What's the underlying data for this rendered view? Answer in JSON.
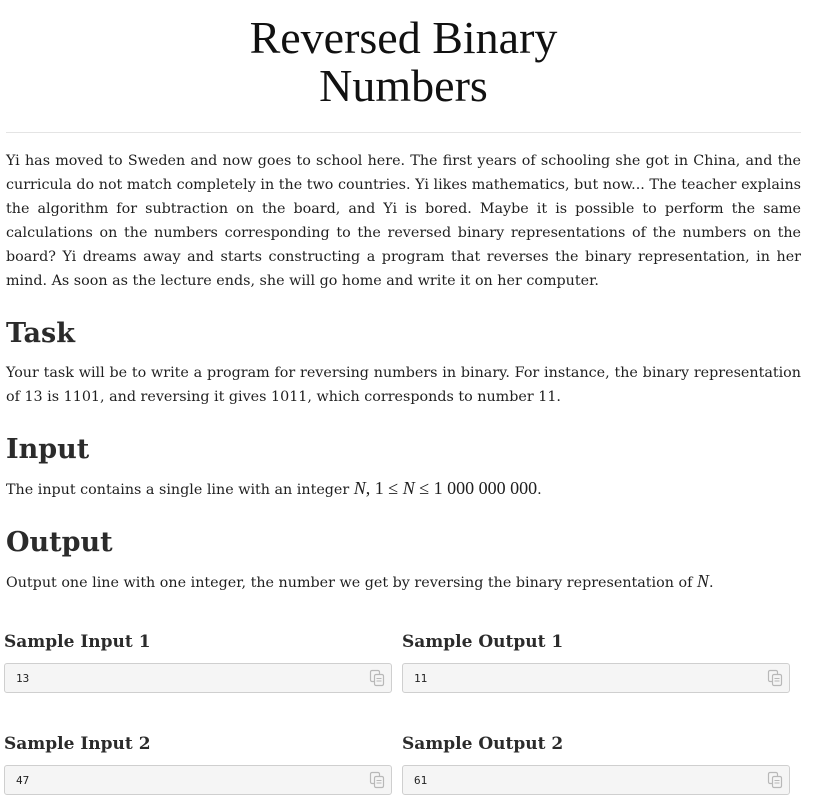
{
  "title": "Reversed Binary Numbers",
  "intro": "Yi has moved to Sweden and now goes to school here. The first years of schooling she got in China, and the curricula do not match completely in the two countries. Yi likes mathematics, but now... The teacher explains the algorithm for subtraction on the board, and Yi is bored. Maybe it is possible to perform the same calculations on the numbers corresponding to the reversed binary representations of the numbers on the board? Yi dreams away and starts constructing a program that reverses the binary representation, in her mind. As soon as the lecture ends, she will go home and write it on her computer.",
  "task": {
    "heading": "Task",
    "text": "Your task will be to write a program for reversing numbers in binary. For instance, the binary representation of 13 is 1101, and reversing it gives 1011, which corresponds to number 11."
  },
  "input": {
    "heading": "Input",
    "text_before": "The input contains a single line with an integer ",
    "var": "N",
    "math_mid": ", 1 ≤ ",
    "var2": "N",
    "math_end": " ≤ 1 000 000 000",
    "text_after": "."
  },
  "output": {
    "heading": "Output",
    "text_before": "Output one line with one integer, the number we get by reversing the binary representation of ",
    "var": "N",
    "text_after": "."
  },
  "samples": [
    {
      "input_label": "Sample Input 1",
      "input_value": "13",
      "output_label": "Sample Output 1",
      "output_value": "11"
    },
    {
      "input_label": "Sample Input 2",
      "input_value": "47",
      "output_label": "Sample Output 2",
      "output_value": "61"
    }
  ],
  "icons": {
    "copy": "copy-icon"
  }
}
